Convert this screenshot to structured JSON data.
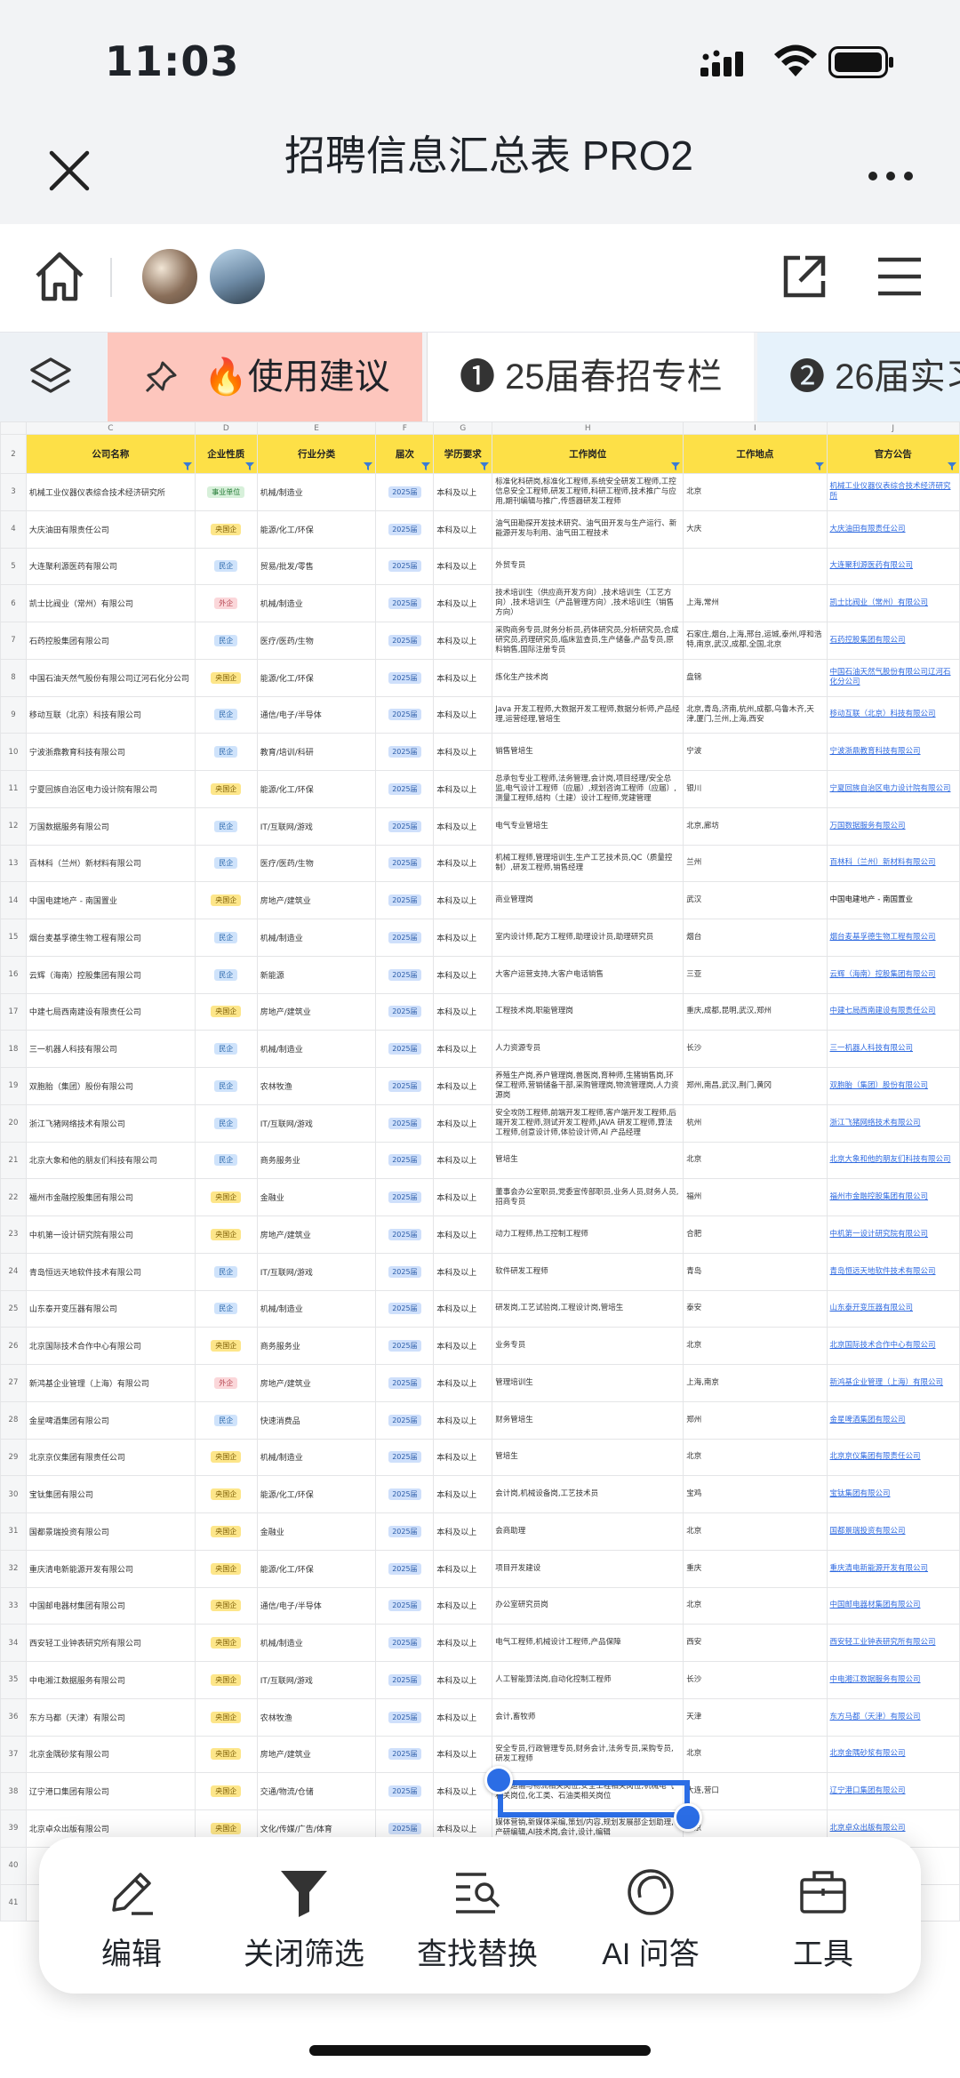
{
  "status_bar": {
    "time": "11:03"
  },
  "title_bar": {
    "title": "招聘信息汇总表 PRO2"
  },
  "tabs": [
    {
      "label": "🔥使用建议"
    },
    {
      "label": "❶ 25届春招专栏"
    },
    {
      "label": "❷ 26届实习"
    }
  ],
  "sheet": {
    "column_letters": [
      "C",
      "D",
      "E",
      "F",
      "G",
      "H",
      "I",
      "J"
    ],
    "header_row_number": "2",
    "headers": [
      "公司名称",
      "企业性质",
      "行业分类",
      "届次",
      "学历要求",
      "工作岗位",
      "工作地点",
      "官方公告"
    ],
    "rows": [
      {
        "n": "3",
        "company": "机械工业仪器仪表综合技术经济研究所",
        "type": "事业单位",
        "industry": "机械/制造业",
        "year": "2025届",
        "edu": "本科及以上",
        "job": "标准化科研岗,标准化工程师,系统安全研发工程师,工控信息安全工程师,研发工程师,科研工程师,技术推广与应用,期刊编辑与推广,传感器研发工程师",
        "loc": "北京",
        "ann": "机械工业仪器仪表综合技术经济研究所"
      },
      {
        "n": "4",
        "company": "大庆油田有限责任公司",
        "type": "央国企",
        "industry": "能源/化工/环保",
        "year": "2025届",
        "edu": "本科及以上",
        "job": "油气田勘探开发技术研究、油气田开发与生产运行、新能源开发与利用、油气田工程技术",
        "loc": "大庆",
        "ann": "大庆油田有限责任公司"
      },
      {
        "n": "5",
        "company": "大连聚利源医药有限公司",
        "type": "民企",
        "industry": "贸易/批发/零售",
        "year": "2025届",
        "edu": "本科及以上",
        "job": "外贸专员",
        "loc": "",
        "ann": "大连聚利源医药有限公司"
      },
      {
        "n": "6",
        "company": "凯士比阀业（常州）有限公司",
        "type": "外企",
        "industry": "机械/制造业",
        "year": "2025届",
        "edu": "本科及以上",
        "job": "技术培训生（供应商开发方向）,技术培训生（工艺方向）,技术培训生（产品管理方向）,技术培训生（销售方向）",
        "loc": "上海,常州",
        "ann": "凯士比阀业（常州）有限公司"
      },
      {
        "n": "7",
        "company": "石药控股集团有限公司",
        "type": "民企",
        "industry": "医疗/医药/生物",
        "year": "2025届",
        "edu": "本科及以上",
        "job": "采购商务专员,财务分析员,药体研究员,分析研究员,合成研究员,药理研究员,临床监查员,生产储备,产品专员,原料销售,国际注册专员",
        "loc": "石家庄,烟台,上海,邢台,运城,泰州,呼和浩特,南京,武汉,成都,全国,北京",
        "ann": "石药控股集团有限公司"
      },
      {
        "n": "8",
        "company": "中国石油天然气股份有限公司辽河石化分公司",
        "type": "央国企",
        "industry": "能源/化工/环保",
        "year": "2025届",
        "edu": "本科及以上",
        "job": "炼化生产技术岗",
        "loc": "盘锦",
        "ann": "中国石油天然气股份有限公司辽河石化分公司"
      },
      {
        "n": "9",
        "company": "移动互联（北京）科技有限公司",
        "type": "民企",
        "industry": "通信/电子/半导体",
        "year": "2025届",
        "edu": "本科及以上",
        "job": "Java 开发工程师,大数据开发工程师,数据分析师,产品经理,运营经理,管培生",
        "loc": "北京,青岛,济南,杭州,成都,乌鲁木齐,天津,厦门,兰州,上海,西安",
        "ann": "移动互联（北京）科技有限公司"
      },
      {
        "n": "10",
        "company": "宁波浙鼎教育科技有限公司",
        "type": "民企",
        "industry": "教育/培训/科研",
        "year": "2025届",
        "edu": "本科及以上",
        "job": "销售管培生",
        "loc": "宁波",
        "ann": "宁波浙鼎教育科技有限公司"
      },
      {
        "n": "11",
        "company": "宁夏回族自治区电力设计院有限公司",
        "type": "央国企",
        "industry": "能源/化工/环保",
        "year": "2025届",
        "edu": "本科及以上",
        "job": "总承包专业工程师,法务管理,会计岗,项目经理/安全总监,电气设计工程师（应届）,规划咨询工程师（应届）,测量工程师,结构（土建）设计工程师,党建管理",
        "loc": "银川",
        "ann": "宁夏回族自治区电力设计院有限公司"
      },
      {
        "n": "12",
        "company": "万国数据服务有限公司",
        "type": "民企",
        "industry": "IT/互联网/游戏",
        "year": "2025届",
        "edu": "本科及以上",
        "job": "电气专业管培生",
        "loc": "北京,廊坊",
        "ann": "万国数据服务有限公司"
      },
      {
        "n": "13",
        "company": "百林科（兰州）新材料有限公司",
        "type": "民企",
        "industry": "医疗/医药/生物",
        "year": "2025届",
        "edu": "本科及以上",
        "job": "机械工程师,管理培训生,生产工艺技术员,QC（质量控制）,研发工程师,销售经理",
        "loc": "兰州",
        "ann": "百林科（兰州）新材料有限公司"
      },
      {
        "n": "14",
        "company": "中国电建地产 - 南国置业",
        "type": "央国企",
        "industry": "房地产/建筑业",
        "year": "2025届",
        "edu": "本科及以上",
        "job": "商业管理岗",
        "loc": "武汉",
        "ann": "中国电建地产 - 南国置业"
      },
      {
        "n": "15",
        "company": "烟台麦基孚德生物工程有限公司",
        "type": "民企",
        "industry": "机械/制造业",
        "year": "2025届",
        "edu": "本科及以上",
        "job": "室内设计师,配方工程师,助理设计员,助理研究员",
        "loc": "烟台",
        "ann": "烟台麦基孚德生物工程有限公司"
      },
      {
        "n": "16",
        "company": "云辉（海南）控股集团有限公司",
        "type": "民企",
        "industry": "新能源",
        "year": "2025届",
        "edu": "本科及以上",
        "job": "大客户运营支持,大客户电话销售",
        "loc": "三亚",
        "ann": "云辉（海南）控股集团有限公司"
      },
      {
        "n": "17",
        "company": "中建七局西南建设有限责任公司",
        "type": "央国企",
        "industry": "房地产/建筑业",
        "year": "2025届",
        "edu": "本科及以上",
        "job": "工程技术岗,职能管理岗",
        "loc": "重庆,成都,昆明,武汉,郑州",
        "ann": "中建七局西南建设有限责任公司"
      },
      {
        "n": "18",
        "company": "三一机器人科技有限公司",
        "type": "民企",
        "industry": "机械/制造业",
        "year": "2025届",
        "edu": "本科及以上",
        "job": "人力资源专员",
        "loc": "长沙",
        "ann": "三一机器人科技有限公司"
      },
      {
        "n": "19",
        "company": "双胞胎（集团）股份有限公司",
        "type": "民企",
        "industry": "农林牧渔",
        "year": "2025届",
        "edu": "本科及以上",
        "job": "养殖生产岗,养户管理岗,兽医岗,育种师,生猪销售岗,环保工程师,营销储备干部,采购管理岗,物流管理岗,人力资源岗",
        "loc": "郑州,南昌,武汉,荆门,黄冈",
        "ann": "双胞胎（集团）股份有限公司"
      },
      {
        "n": "20",
        "company": "浙江飞猪网络技术有限公司",
        "type": "民企",
        "industry": "IT/互联网/游戏",
        "year": "2025届",
        "edu": "本科及以上",
        "job": "安全攻防工程师,前端开发工程师,客户端开发工程师,后端开发工程师,测试开发工程师,JAVA 研发工程师,算法工程师,创意设计师,体验设计师,AI 产品经理",
        "loc": "杭州",
        "ann": "浙江飞猪网络技术有限公司"
      },
      {
        "n": "21",
        "company": "北京大象和他的朋友们科技有限公司",
        "type": "民企",
        "industry": "商务服务业",
        "year": "2025届",
        "edu": "本科及以上",
        "job": "管培生",
        "loc": "北京",
        "ann": "北京大象和他的朋友们科技有限公司"
      },
      {
        "n": "22",
        "company": "福州市金融控股集团有限公司",
        "type": "央国企",
        "industry": "金融业",
        "year": "2025届",
        "edu": "本科及以上",
        "job": "董事会办公室职员,党委宣传部职员,业务人员,财务人员,招商专员",
        "loc": "福州",
        "ann": "福州市金融控股集团有限公司"
      },
      {
        "n": "23",
        "company": "中机第一设计研究院有限公司",
        "type": "央国企",
        "industry": "房地产/建筑业",
        "year": "2025届",
        "edu": "本科及以上",
        "job": "动力工程师,热工控制工程师",
        "loc": "合肥",
        "ann": "中机第一设计研究院有限公司"
      },
      {
        "n": "24",
        "company": "青岛恒远天地软件技术有限公司",
        "type": "民企",
        "industry": "IT/互联网/游戏",
        "year": "2025届",
        "edu": "本科及以上",
        "job": "软件研发工程师",
        "loc": "青岛",
        "ann": "青岛恒远天地软件技术有限公司"
      },
      {
        "n": "25",
        "company": "山东泰开变压器有限公司",
        "type": "民企",
        "industry": "机械/制造业",
        "year": "2025届",
        "edu": "本科及以上",
        "job": "研发岗,工艺试验岗,工程设计岗,管培生",
        "loc": "泰安",
        "ann": "山东泰开变压器有限公司"
      },
      {
        "n": "26",
        "company": "北京国际技术合作中心有限公司",
        "type": "央国企",
        "industry": "商务服务业",
        "year": "2025届",
        "edu": "本科及以上",
        "job": "业务专员",
        "loc": "北京",
        "ann": "北京国际技术合作中心有限公司"
      },
      {
        "n": "27",
        "company": "新鸿基企业管理（上海）有限公司",
        "type": "外企",
        "industry": "房地产/建筑业",
        "year": "2025届",
        "edu": "本科及以上",
        "job": "管理培训生",
        "loc": "上海,南京",
        "ann": "新鸿基企业管理（上海）有限公司"
      },
      {
        "n": "28",
        "company": "金星啤酒集团有限公司",
        "type": "民企",
        "industry": "快速消费品",
        "year": "2025届",
        "edu": "本科及以上",
        "job": "财务管培生",
        "loc": "郑州",
        "ann": "金星啤酒集团有限公司"
      },
      {
        "n": "29",
        "company": "北京京仪集团有限责任公司",
        "type": "央国企",
        "industry": "机械/制造业",
        "year": "2025届",
        "edu": "本科及以上",
        "job": "管培生",
        "loc": "北京",
        "ann": "北京京仪集团有限责任公司"
      },
      {
        "n": "30",
        "company": "宝钛集团有限公司",
        "type": "央国企",
        "industry": "能源/化工/环保",
        "year": "2025届",
        "edu": "本科及以上",
        "job": "会计岗,机械设备岗,工艺技术员",
        "loc": "宝鸡",
        "ann": "宝钛集团有限公司"
      },
      {
        "n": "31",
        "company": "国都景瑞投资有限公司",
        "type": "央国企",
        "industry": "金融业",
        "year": "2025届",
        "edu": "本科及以上",
        "job": "会商助理",
        "loc": "北京",
        "ann": "国都景瑞投资有限公司"
      },
      {
        "n": "32",
        "company": "重庆清电新能源开发有限公司",
        "type": "央国企",
        "industry": "能源/化工/环保",
        "year": "2025届",
        "edu": "本科及以上",
        "job": "项目开发建设",
        "loc": "重庆",
        "ann": "重庆清电新能源开发有限公司"
      },
      {
        "n": "33",
        "company": "中国邮电器材集团有限公司",
        "type": "央国企",
        "industry": "通信/电子/半导体",
        "year": "2025届",
        "edu": "本科及以上",
        "job": "办公室研究员岗",
        "loc": "北京",
        "ann": "中国邮电器材集团有限公司"
      },
      {
        "n": "34",
        "company": "西安轻工业钟表研究所有限公司",
        "type": "央国企",
        "industry": "机械/制造业",
        "year": "2025届",
        "edu": "本科及以上",
        "job": "电气工程师,机械设计工程师,产品保障",
        "loc": "西安",
        "ann": "西安轻工业钟表研究所有限公司"
      },
      {
        "n": "35",
        "company": "中电湘江数据服务有限公司",
        "type": "央国企",
        "industry": "IT/互联网/游戏",
        "year": "2025届",
        "edu": "本科及以上",
        "job": "人工智能算法岗,自动化控制工程师",
        "loc": "长沙",
        "ann": "中电湘江数据服务有限公司"
      },
      {
        "n": "36",
        "company": "东方马都（天津）有限公司",
        "type": "央国企",
        "industry": "农林牧渔",
        "year": "2025届",
        "edu": "本科及以上",
        "job": "会计,畜牧师",
        "loc": "天津",
        "ann": "东方马都（天津）有限公司"
      },
      {
        "n": "37",
        "company": "北京金隅砂浆有限公司",
        "type": "央国企",
        "industry": "房地产/建筑业",
        "year": "2025届",
        "edu": "本科及以上",
        "job": "安全专员,行政管理专员,财务会计,法务专员,采购专员,研发工程师",
        "loc": "北京",
        "ann": "北京金隅砂浆有限公司"
      },
      {
        "n": "38",
        "company": "辽宁港口集团有限公司",
        "type": "央国企",
        "industry": "交通/物流/仓储",
        "year": "2025届",
        "edu": "本科及以上",
        "job": "交通运输与物流相关岗位,安全工程相关岗位,机械电气相关岗位,化工类、石油类相关岗位",
        "loc": "大连,营口",
        "ann": "辽宁港口集团有限公司"
      },
      {
        "n": "39",
        "company": "北京卓众出版有限公司",
        "type": "央国企",
        "industry": "文化/传媒/广告/体育",
        "year": "2025届",
        "edu": "本科及以上",
        "job": "媒体营销,新媒体采编,策划/内容,规划发展部企划助理,产研编辑,AI技术岗,会计,设计,编辑",
        "loc": "北京",
        "ann": "北京卓众出版有限公司"
      },
      {
        "n": "40",
        "company": "",
        "type": "",
        "industry": "",
        "year": "",
        "edu": "",
        "job": "",
        "loc": "",
        "ann": "有限公司"
      },
      {
        "n": "41",
        "company": "",
        "type": "",
        "industry": "",
        "year": "",
        "edu": "",
        "job": "",
        "loc": "",
        "ann": "有限公司"
      }
    ]
  },
  "bottom_bar": [
    {
      "label": "编辑",
      "icon": "pencil-icon"
    },
    {
      "label": "关闭筛选",
      "icon": "filter-icon"
    },
    {
      "label": "查找替换",
      "icon": "find-replace-icon"
    },
    {
      "label": "AI 问答",
      "icon": "ai-icon"
    },
    {
      "label": "工具",
      "icon": "toolbox-icon"
    }
  ],
  "colors": {
    "accent": "#2b6de5",
    "header_fill": "#fde047",
    "tab_active": "#fdc6bd"
  }
}
